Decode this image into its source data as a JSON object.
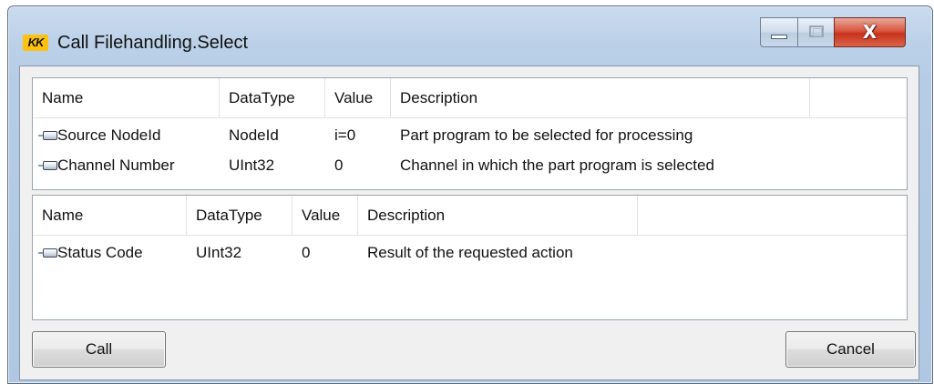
{
  "window": {
    "title": "Call Filehandling.Select",
    "logo_text": "KK",
    "controls": {
      "minimize": "minimize",
      "maximize": "maximize",
      "close_glyph": "X"
    }
  },
  "inputs": {
    "columns": [
      "Name",
      "DataType",
      "Value",
      "Description"
    ],
    "rows": [
      {
        "name": "Source NodeId",
        "datatype": "NodeId",
        "value": "i=0",
        "description": "Part program to be selected for processing"
      },
      {
        "name": "Channel Number",
        "datatype": "UInt32",
        "value": "0",
        "description": "Channel in which the part program is selected"
      }
    ]
  },
  "outputs": {
    "columns": [
      "Name",
      "DataType",
      "Value",
      "Description"
    ],
    "rows": [
      {
        "name": "Status Code",
        "datatype": "UInt32",
        "value": "0",
        "description": "Result of the requested action"
      }
    ]
  },
  "buttons": {
    "call": "Call",
    "cancel": "Cancel"
  },
  "icons": {
    "row_icon": "parameter-pin-icon"
  },
  "colors": {
    "title_bar": "#bcd1e8",
    "close_button": "#c7331c",
    "logo": "#ffc20e"
  }
}
